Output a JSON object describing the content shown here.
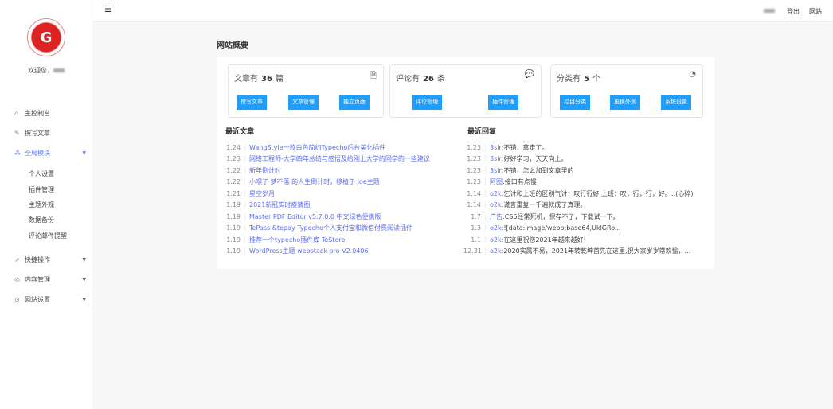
{
  "sidebar": {
    "welcome": "欢迎您，",
    "items": [
      {
        "label": "主控制台",
        "icon": "home-icon"
      },
      {
        "label": "撰写文章",
        "icon": "edit-icon"
      },
      {
        "label": "全局模块",
        "icon": "modules-icon",
        "expanded": true,
        "children": [
          "个人设置",
          "插件管理",
          "主题外观",
          "数据备份",
          "评论邮件提醒"
        ]
      },
      {
        "label": "快捷操作",
        "icon": "shortcut-icon"
      },
      {
        "label": "内容管理",
        "icon": "content-icon"
      },
      {
        "label": "网站设置",
        "icon": "settings-icon"
      }
    ]
  },
  "header": {
    "logout": "登出",
    "site": "网站"
  },
  "main": {
    "title": "网站概要",
    "cards": [
      {
        "prefix": "文章有",
        "count": "36",
        "unit": "篇",
        "icon": "document-icon",
        "buttons": [
          "撰写文章",
          "文章管理",
          "独立页面"
        ]
      },
      {
        "prefix": "评论有",
        "count": "26",
        "unit": "条",
        "icon": "comment-icon",
        "buttons": [
          "评论管理",
          "插件管理"
        ]
      },
      {
        "prefix": "分类有",
        "count": "5",
        "unit": "个",
        "icon": "pie-chart-icon",
        "buttons": [
          "栏目分类",
          "更换外观",
          "系统设置"
        ]
      }
    ],
    "recent_posts_title": "最近文章",
    "recent_posts": [
      {
        "date": "1.24",
        "title": "WangStyle一款白色简约Typecho后台美化插件"
      },
      {
        "date": "1.23",
        "title": "网络工程师-大学四年总结与感悟及给刚上大学的同学的一些建议"
      },
      {
        "date": "1.22",
        "title": "新年倒计时"
      },
      {
        "date": "1.22",
        "title": "小嘿了 梦不落 的人生倒计时，移植于 Joe主题"
      },
      {
        "date": "1.21",
        "title": "星空岁月"
      },
      {
        "date": "1.19",
        "title": "2021新冠实时疫情图"
      },
      {
        "date": "1.19",
        "title": "Master PDF Editor v5.7.0.0 中文绿色便携版"
      },
      {
        "date": "1.19",
        "title": "TePass &tepay Typecho个人支付宝和微信付费阅读插件"
      },
      {
        "date": "1.19",
        "title": "推荐一个typecho插件库 TeStore"
      },
      {
        "date": "1.19",
        "title": "WordPress主题 webstack pro V2.0406"
      }
    ],
    "recent_replies_title": "最近回复",
    "recent_replies": [
      {
        "date": "1.23",
        "author": "3sir",
        "text": "不错，拿走了。"
      },
      {
        "date": "1.23",
        "author": "3sir",
        "text": "好好学习，天天向上。"
      },
      {
        "date": "1.23",
        "author": "3sir",
        "text": "不错，怎么加到文章里的"
      },
      {
        "date": "1.23",
        "author": "阿图",
        "text": "接口有点慢"
      },
      {
        "date": "1.14",
        "author": "o2k",
        "text": "乞讨和上班的区别气讨：叹行行好 上班：叹，行，行，好。::(心碎)"
      },
      {
        "date": "1.14",
        "author": "o2k",
        "text": "谎言重复一千遍就成了真理。"
      },
      {
        "date": "1.7",
        "author": "广告",
        "text": "CS6经常死机，保存不了，下载试一下。"
      },
      {
        "date": "1.3",
        "author": "o2k",
        "text": "![data:image/webp;base64,UklGRo..."
      },
      {
        "date": "1.1",
        "author": "o2k",
        "text": "在这里祝您2021年越来越好!"
      },
      {
        "date": "12.31",
        "author": "o2k",
        "text": "2020实属不易，2021年转乾坤首先在这里,祝大家岁岁常欢愉，..."
      }
    ]
  },
  "colors": {
    "accent": "#1e9fff",
    "link": "#5b6cf0",
    "active_nav": "#5b7fff"
  }
}
